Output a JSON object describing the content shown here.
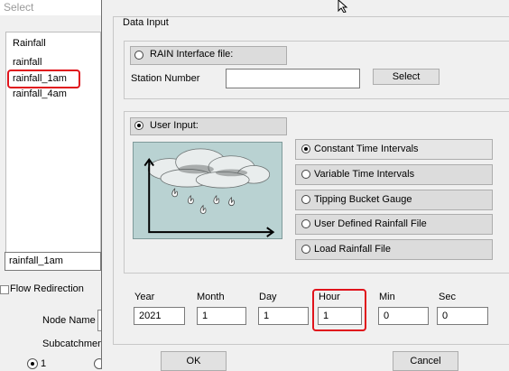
{
  "background_dialog": {
    "title": "Select",
    "list_items": [
      "Rainfall",
      "rainfall",
      "rainfall_1am",
      "rainfall_4am"
    ],
    "selected_item": "rainfall_1am",
    "selected_value": "rainfall_1am",
    "flow_label": "Flow Redirection",
    "node_name_label": "Node Name",
    "subcatchment_label": "Subcatchment",
    "radio_label": "1"
  },
  "dialog": {
    "group_label": "Data Input",
    "rain_interface_label": "RAIN Interface file:",
    "station_number_label": "Station Number",
    "station_number_value": "",
    "select_button": "Select",
    "user_input_label": "User Input:",
    "options": [
      {
        "label": "Constant Time Intervals",
        "selected": true
      },
      {
        "label": "Variable Time Intervals",
        "selected": false
      },
      {
        "label": "Tipping Bucket Gauge",
        "selected": false
      },
      {
        "label": "User Defined Rainfall File",
        "selected": false
      },
      {
        "label": "Load Rainfall File",
        "selected": false
      }
    ],
    "fields": {
      "year": {
        "label": "Year",
        "value": "2021"
      },
      "month": {
        "label": "Month",
        "value": "1"
      },
      "day": {
        "label": "Day",
        "value": "1"
      },
      "hour": {
        "label": "Hour",
        "value": "1"
      },
      "min": {
        "label": "Min",
        "value": "0"
      },
      "sec": {
        "label": "Sec",
        "value": "0"
      }
    },
    "ok_button": "OK",
    "cancel_button": "Cancel"
  },
  "colors": {
    "highlight_ring": "#e0141c",
    "illustration_bg": "#b9d2d2"
  },
  "icons": [
    "mouse-cursor-icon",
    "rain-cloud-icon"
  ]
}
